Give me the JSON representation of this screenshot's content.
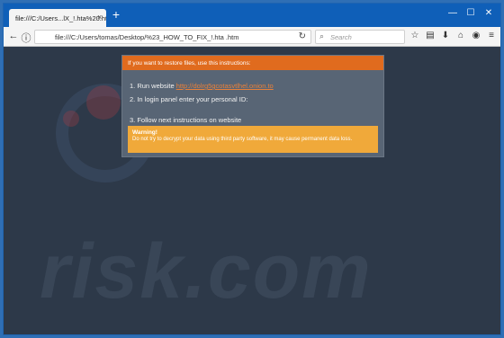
{
  "browser": {
    "tab_title": "file:///C:/Users...lX_!.hta%20.htm",
    "tab_close": "×",
    "new_tab": "+",
    "url": "file:///C:/Users/tomas/Desktop/%23_HOW_TO_FIX_!.hta .htm",
    "search_placeholder": "Search"
  },
  "ransom": {
    "header": "If you want to restore files, use this instructions:",
    "step1_prefix": "1. Run website",
    "step1_link": "http://dolrg5gcotasvtlhel.onion.to",
    "step2": "2. In login panel enter your personal ID:",
    "step3": "3. Follow next instructions on website",
    "warning_title": "Warning!",
    "warning_text": "Do not try to decrypt your data using third party software, it may cause permanent data loss."
  },
  "watermark": {
    "text": "risk.com"
  },
  "colors": {
    "header_orange": "#e06b1e",
    "warning_orange": "#f0a93a",
    "link": "#e8803a",
    "dialog_bg": "#586575",
    "page_bg": "#2d3949",
    "titlebar": "#0f5fb8"
  }
}
